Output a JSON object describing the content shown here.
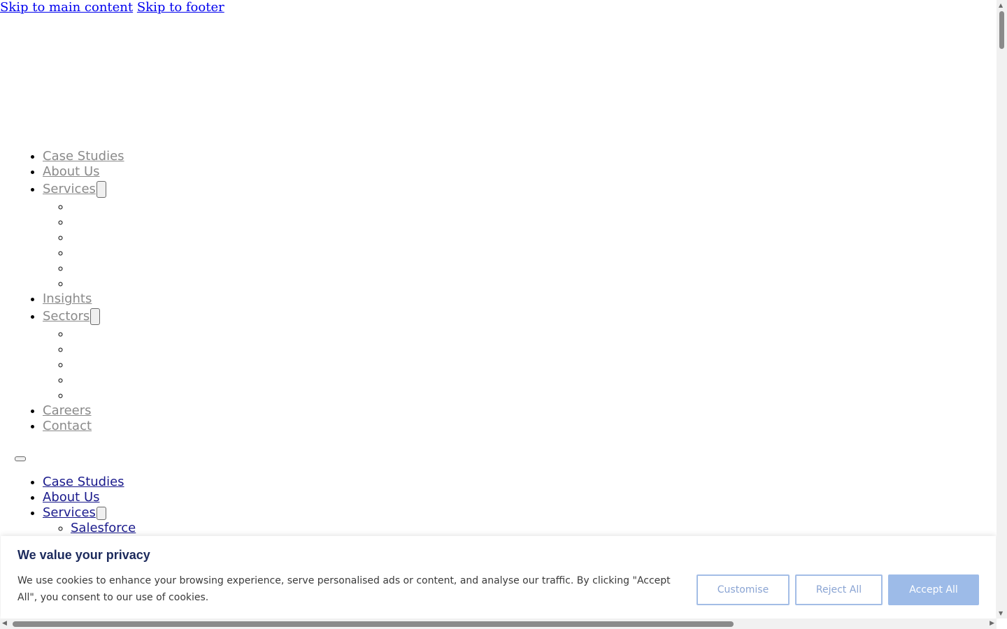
{
  "skip_links": [
    "Skip to main content",
    "Skip to footer"
  ],
  "primary_nav": {
    "items": [
      "Case Studies",
      "About Us",
      "Services",
      "Insights",
      "Sectors",
      "Careers",
      "Contact"
    ]
  },
  "mobile_nav": {
    "items": [
      "Case Studies",
      "About Us",
      "Services"
    ],
    "services_sub": [
      "Salesforce"
    ]
  },
  "cookie_banner": {
    "title": "We value your privacy",
    "text": "We use cookies to enhance your browsing experience, serve personalised ads or content, and analyse our traffic. By clicking \"Accept All\", you consent to our use of cookies.",
    "customise_label": "Customise",
    "reject_label": "Reject All",
    "accept_label": "Accept All"
  },
  "colors": {
    "nav_link": "#8a8a8a",
    "mobile_link": "#1a1a8c",
    "banner_title": "#1c2a5c",
    "button_outline": "#a3bde6",
    "accept_bg": "#9dbbe8"
  }
}
